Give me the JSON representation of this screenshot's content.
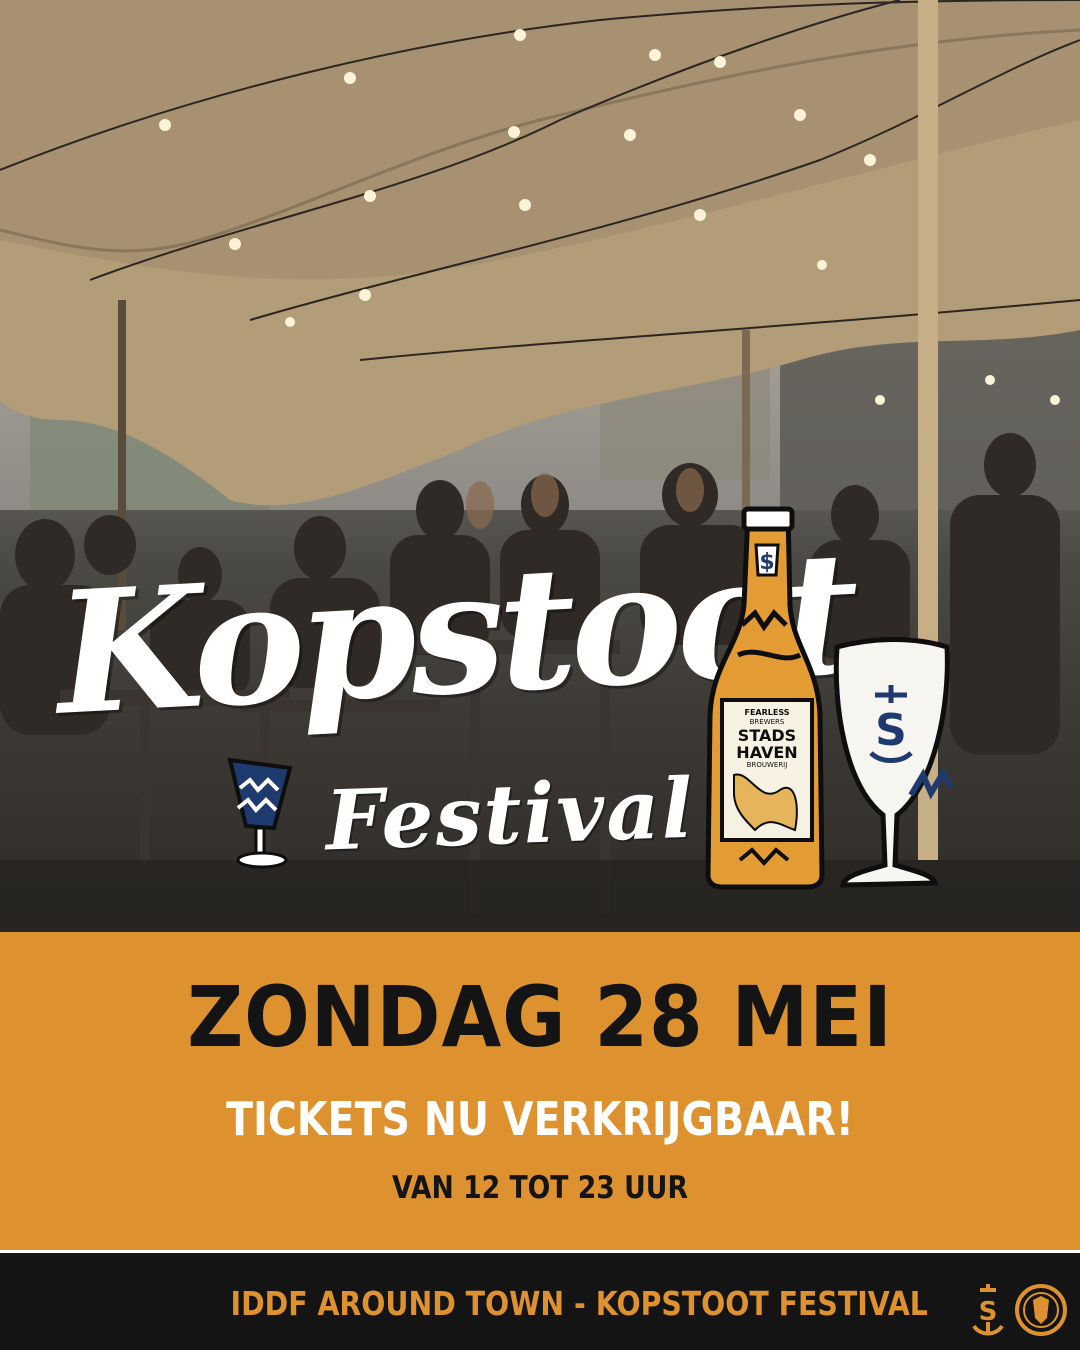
{
  "event": {
    "logo_main": "Kopstoot",
    "logo_sub": "Festival",
    "date": "ZONDAG 28 MEI",
    "tickets": "TICKETS NU VERKRIJGBAAR!",
    "hours": "VAN 12 TOT 23 UUR"
  },
  "bottle_label": {
    "line1": "FEARLESS",
    "line2": "BREWERS",
    "brand_top": "STADS",
    "brand_bottom": "HAVEN",
    "sub": "BROUWERIJ"
  },
  "footer": {
    "text": "IDDF AROUND TOWN - KOPSTOOT FESTIVAL",
    "icons": [
      "anchor-s-icon",
      "brewery-seal-icon"
    ]
  },
  "colors": {
    "accent_orange": "#dd922f",
    "dark": "#141414",
    "white": "#ffffff",
    "navy": "#1f3a6e"
  }
}
